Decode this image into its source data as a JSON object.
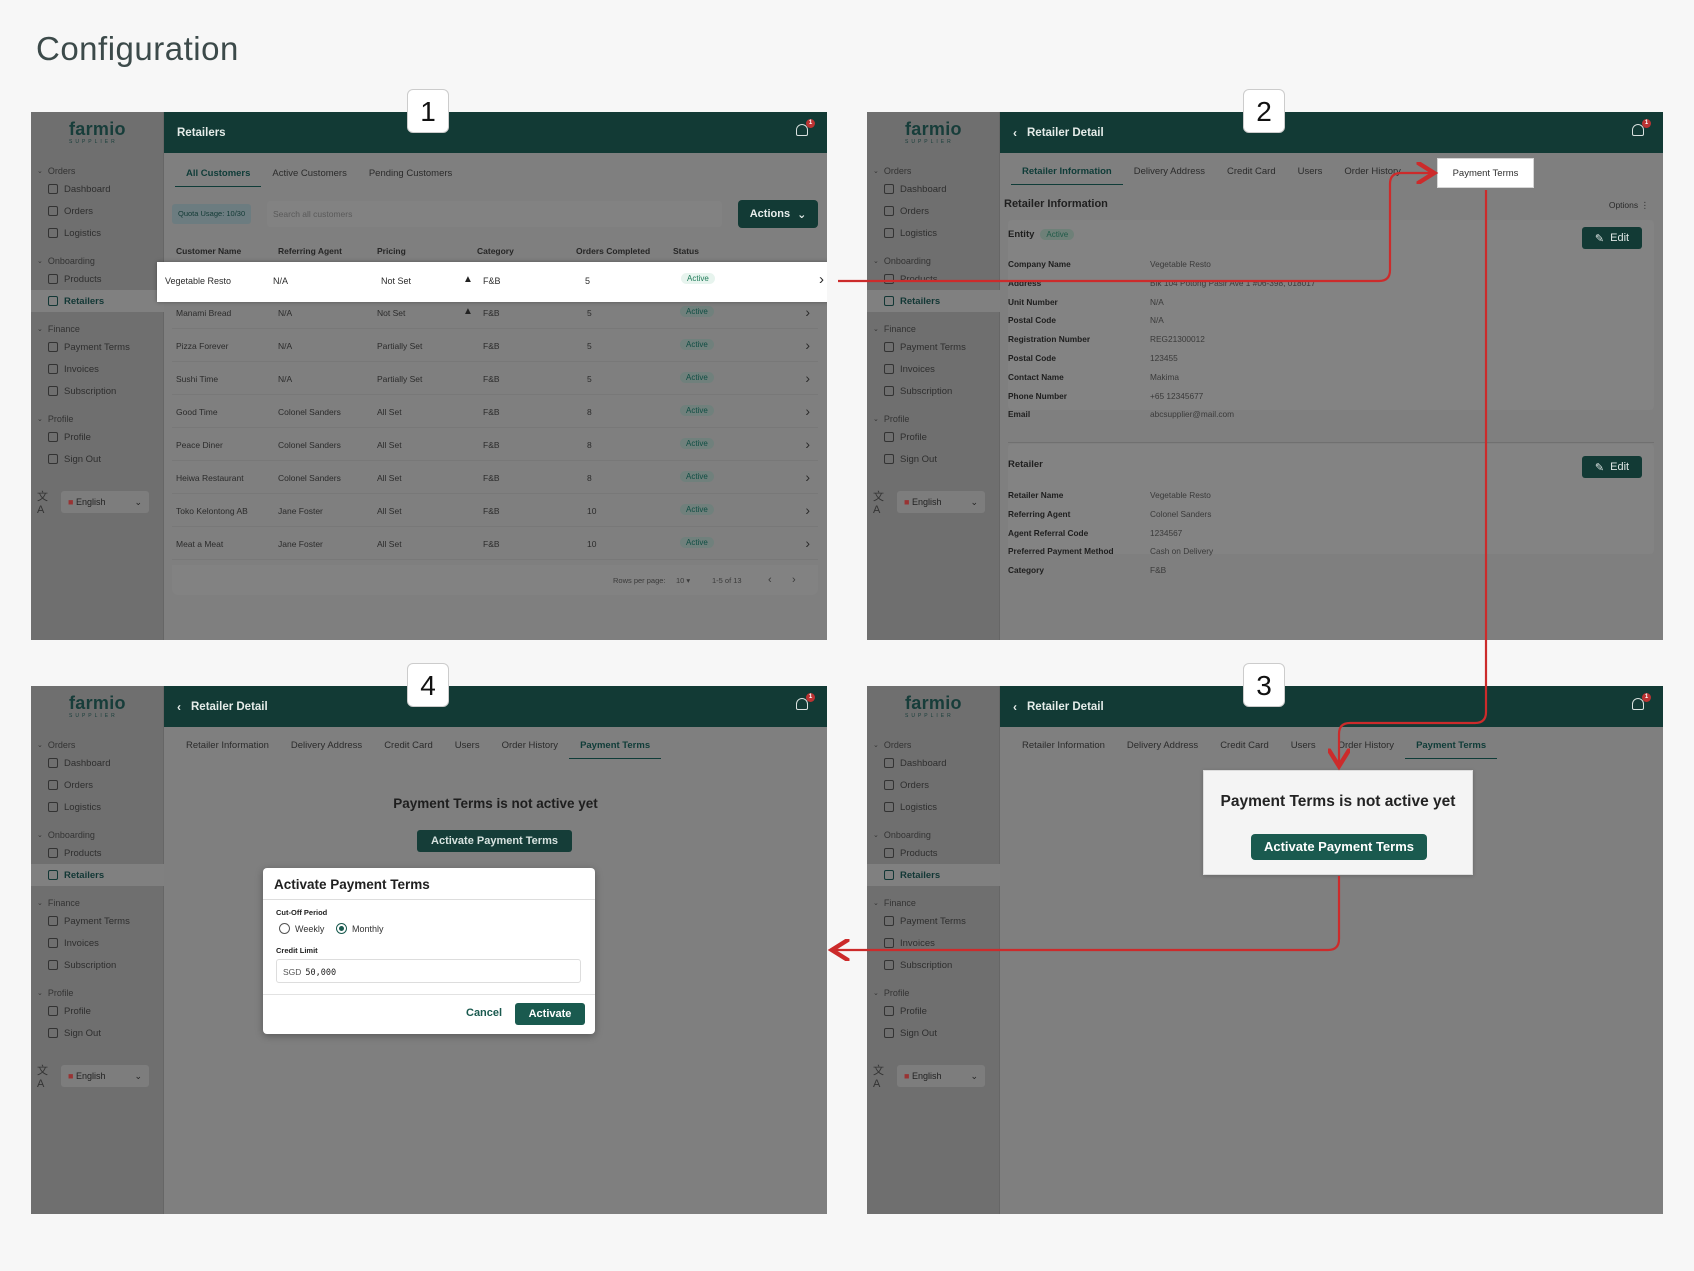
{
  "page_title": "Configuration",
  "step_numbers": [
    "1",
    "2",
    "3",
    "4"
  ],
  "sidebar": {
    "logo": "farmio",
    "logo_sub": "SUPPLIER",
    "groups": [
      {
        "label": "Orders",
        "items": [
          {
            "label": "Dashboard",
            "icon": "dashboard-icon"
          },
          {
            "label": "Orders",
            "icon": "cart-icon"
          },
          {
            "label": "Logistics",
            "icon": "truck-icon"
          }
        ]
      },
      {
        "label": "Onboarding",
        "items": [
          {
            "label": "Products",
            "icon": "box-icon"
          },
          {
            "label": "Retailers",
            "icon": "users-icon",
            "active": true
          }
        ]
      },
      {
        "label": "Finance",
        "items": [
          {
            "label": "Payment Terms",
            "icon": "money-icon"
          },
          {
            "label": "Invoices",
            "icon": "invoice-icon"
          },
          {
            "label": "Subscription",
            "icon": "subscription-icon"
          }
        ]
      },
      {
        "label": "Profile",
        "items": [
          {
            "label": "Profile",
            "icon": "person-icon"
          },
          {
            "label": "Sign Out",
            "icon": "signout-icon"
          }
        ]
      }
    ],
    "language": "English"
  },
  "panel1": {
    "title": "Retailers",
    "tabs": [
      "All Customers",
      "Active Customers",
      "Pending Customers"
    ],
    "quota": "Quota Usage: 10/30",
    "search_placeholder": "Search all customers",
    "actions_label": "Actions",
    "columns": [
      "Customer Name",
      "Referring Agent",
      "Pricing",
      "Category",
      "Orders Completed",
      "Status"
    ],
    "rows": [
      {
        "name": "Vegetable Resto",
        "agent": "N/A",
        "pricing": "Not Set",
        "warn": true,
        "category": "F&B",
        "orders": "5",
        "status": "Active"
      },
      {
        "name": "Manami Bread",
        "agent": "N/A",
        "pricing": "Not Set",
        "warn": true,
        "category": "F&B",
        "orders": "5",
        "status": "Active"
      },
      {
        "name": "Pizza Forever",
        "agent": "N/A",
        "pricing": "Partially Set",
        "warn": false,
        "category": "F&B",
        "orders": "5",
        "status": "Active"
      },
      {
        "name": "Sushi Time",
        "agent": "N/A",
        "pricing": "Partially Set",
        "warn": false,
        "category": "F&B",
        "orders": "5",
        "status": "Active"
      },
      {
        "name": "Good Time",
        "agent": "Colonel Sanders",
        "pricing": "All Set",
        "warn": false,
        "category": "F&B",
        "orders": "8",
        "status": "Active"
      },
      {
        "name": "Peace Diner",
        "agent": "Colonel Sanders",
        "pricing": "All Set",
        "warn": false,
        "category": "F&B",
        "orders": "8",
        "status": "Active"
      },
      {
        "name": "Heiwa Restaurant",
        "agent": "Colonel Sanders",
        "pricing": "All Set",
        "warn": false,
        "category": "F&B",
        "orders": "8",
        "status": "Active"
      },
      {
        "name": "Toko Kelontong AB",
        "agent": "Jane Foster",
        "pricing": "All Set",
        "warn": false,
        "category": "F&B",
        "orders": "10",
        "status": "Active"
      },
      {
        "name": "Meat a Meat",
        "agent": "Jane Foster",
        "pricing": "All Set",
        "warn": false,
        "category": "F&B",
        "orders": "10",
        "status": "Active"
      }
    ],
    "pager": {
      "rows_label": "Rows per page:",
      "rows_value": "10",
      "range": "1-5 of 13"
    }
  },
  "detail_title": "Retailer Detail",
  "detail_tabs": [
    "Retailer Information",
    "Delivery Address",
    "Credit Card",
    "Users",
    "Order History",
    "Payment Terms"
  ],
  "panel2": {
    "section_title": "Retailer Information",
    "options": "Options",
    "entity_label": "Entity",
    "entity_status": "Active",
    "edit_label": "Edit",
    "entity_fields": [
      {
        "k": "Company Name",
        "v": "Vegetable Resto"
      },
      {
        "k": "Address",
        "v": "Blk 104 Potong Pasir Ave 1 #06-398, 018017"
      },
      {
        "k": "Unit Number",
        "v": "N/A"
      },
      {
        "k": "Postal Code",
        "v": "N/A"
      },
      {
        "k": "Registration Number",
        "v": "REG21300012"
      },
      {
        "k": "Postal Code",
        "v": "123455"
      },
      {
        "k": "Contact Name",
        "v": "Makima"
      },
      {
        "k": "Phone Number",
        "v": "+65 12345677"
      },
      {
        "k": "Email",
        "v": "abcsupplier@mail.com"
      }
    ],
    "retailer_label": "Retailer",
    "retailer_fields": [
      {
        "k": "Retailer Name",
        "v": "Vegetable Resto"
      },
      {
        "k": "Referring Agent",
        "v": "Colonel Sanders"
      },
      {
        "k": "Agent Referral Code",
        "v": "1234567"
      },
      {
        "k": "Preferred Payment Method",
        "v": "Cash on Delivery"
      },
      {
        "k": "Category",
        "v": "F&B"
      }
    ],
    "highlight_tab": "Payment Terms"
  },
  "not_active_text": "Payment Terms is not active yet",
  "activate_pt_label": "Activate Payment Terms",
  "modal": {
    "title": "Activate Payment Terms",
    "cutoff_label": "Cut-Off Period",
    "options": [
      "Weekly",
      "Monthly"
    ],
    "selected": "Monthly",
    "credit_label": "Credit Limit",
    "currency": "SGD",
    "credit_value": "50,000",
    "cancel": "Cancel",
    "activate": "Activate"
  },
  "colors": {
    "brand_dark": "#123a35",
    "accent": "#1a5a4f",
    "arrow": "#cc2b2b"
  }
}
